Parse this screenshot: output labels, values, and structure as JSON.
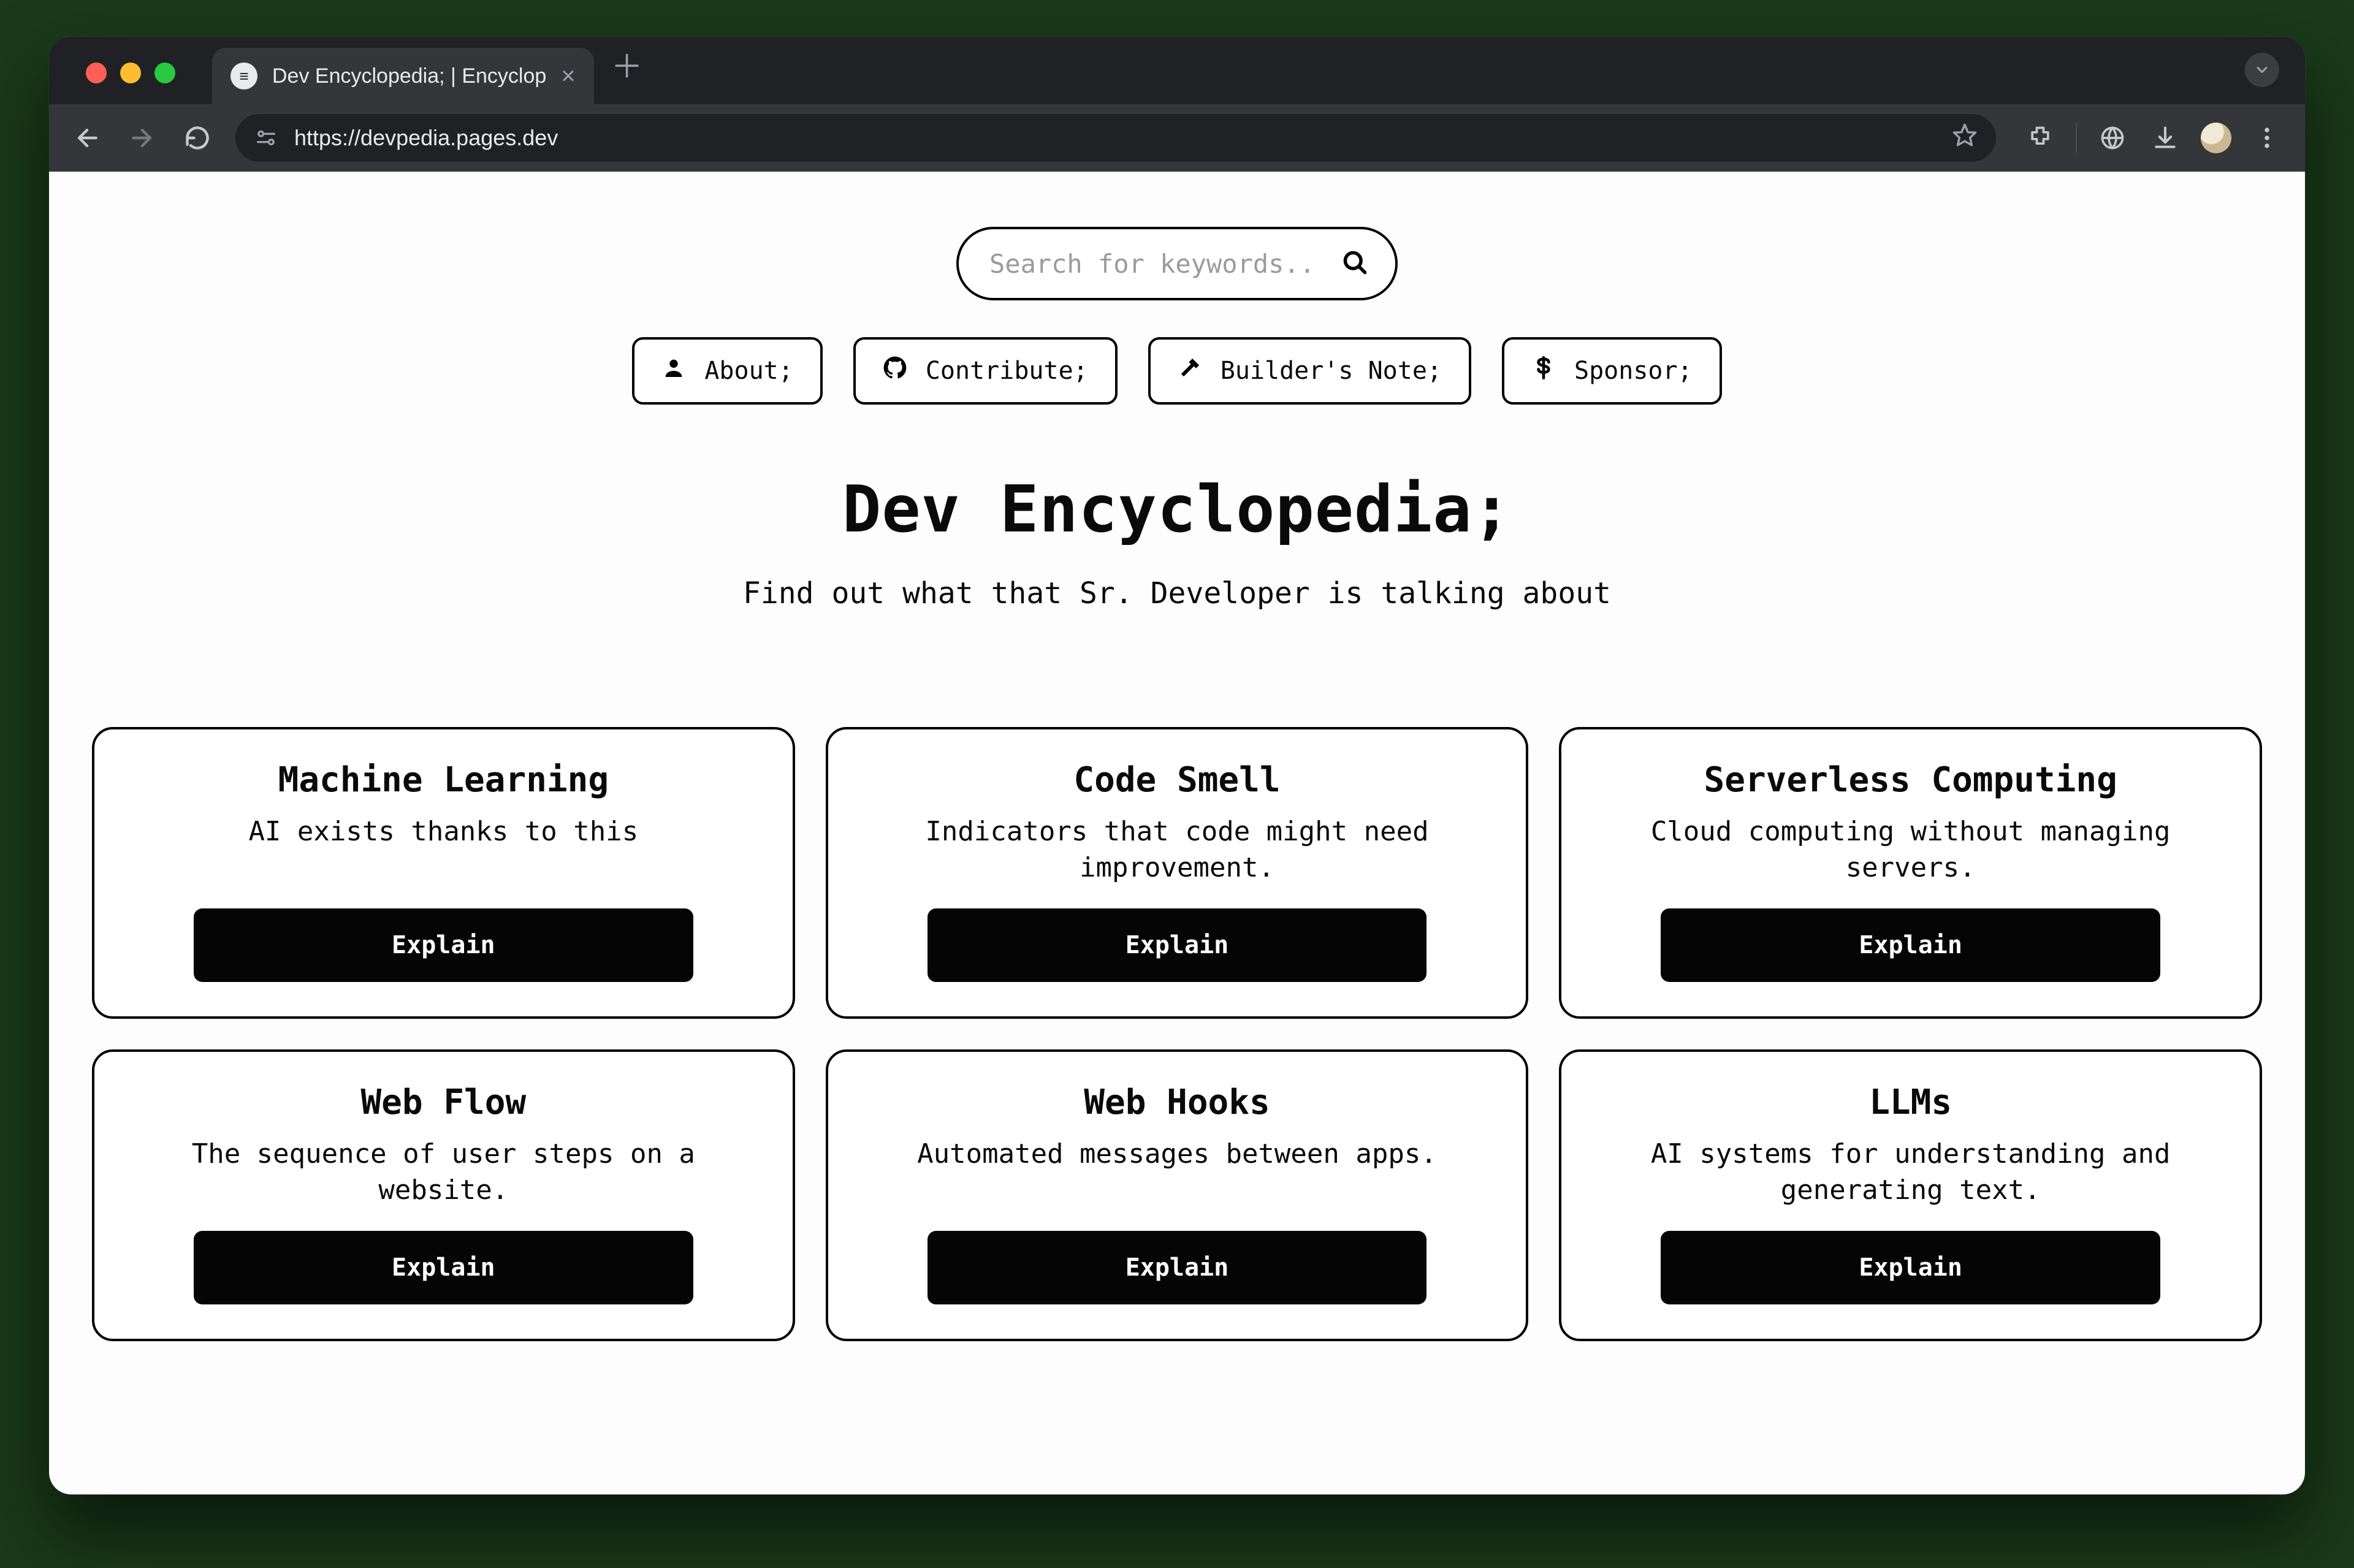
{
  "browser": {
    "tab_title": "Dev Encyclopedia; | Encyclop",
    "url": "https://devpedia.pages.dev"
  },
  "search": {
    "placeholder": "Search for keywords.."
  },
  "nav": [
    {
      "icon": "person-icon",
      "label": "About;"
    },
    {
      "icon": "github-icon",
      "label": "Contribute;"
    },
    {
      "icon": "hammer-icon",
      "label": "Builder's Note;"
    },
    {
      "icon": "dollar-icon",
      "label": "Sponsor;"
    }
  ],
  "hero": {
    "title": "Dev Encyclopedia;",
    "subtitle": "Find out what that Sr. Developer is talking about"
  },
  "explain_label": "Explain",
  "cards": [
    {
      "title": "Machine Learning",
      "desc": "AI exists thanks to this"
    },
    {
      "title": "Code Smell",
      "desc": "Indicators that code might need improvement."
    },
    {
      "title": "Serverless Computing",
      "desc": "Cloud computing without managing servers."
    },
    {
      "title": "Web Flow",
      "desc": "The sequence of user steps on a website."
    },
    {
      "title": "Web Hooks",
      "desc": "Automated messages between apps."
    },
    {
      "title": "LLMs",
      "desc": "AI systems for understanding and generating text."
    }
  ]
}
